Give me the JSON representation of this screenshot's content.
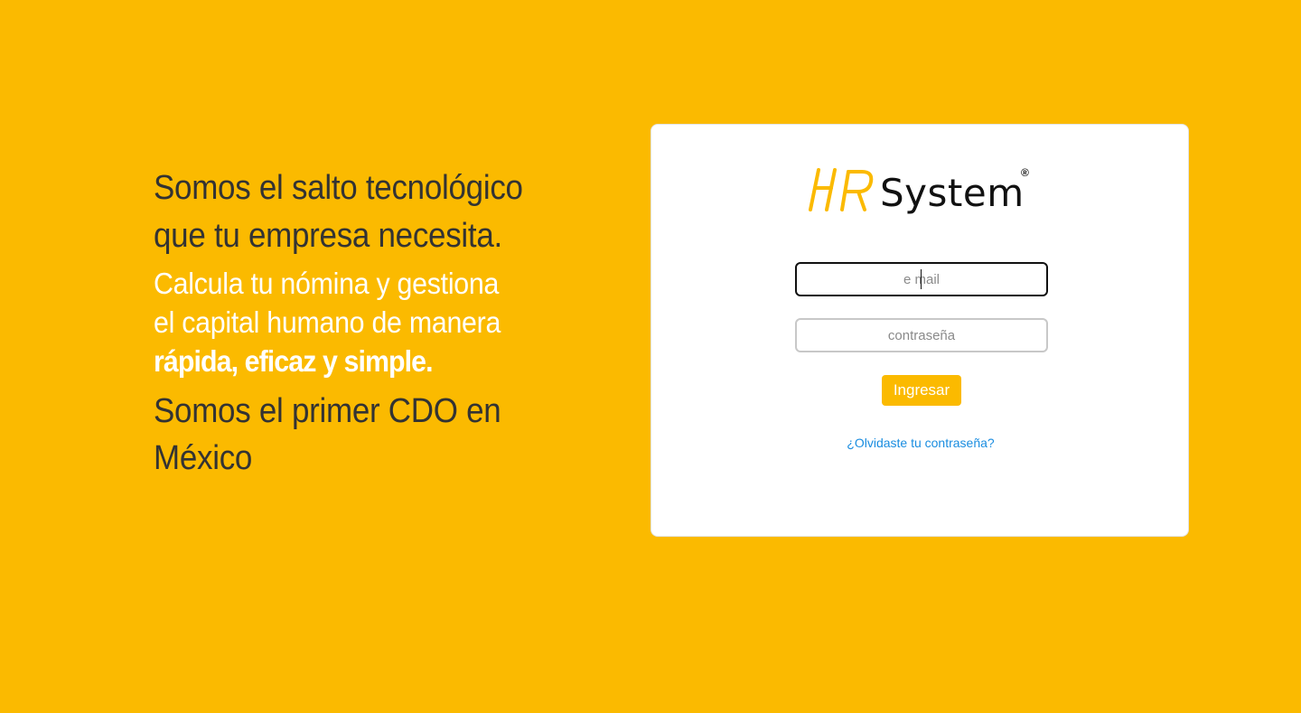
{
  "hero": {
    "headline_1": "Somos el salto tecnológico",
    "headline_2": "que tu empresa necesita.",
    "sub_1": "Calcula tu nómina y gestiona",
    "sub_2": "el capital humano de manera",
    "sub_bold": "rápida, eficaz y simple.",
    "cdo_1": "Somos el primer CDO en",
    "cdo_2": "México"
  },
  "logo": {
    "name": "System",
    "registered": "®",
    "mark_text": "HR",
    "mark_color": "#FBBA00"
  },
  "login": {
    "email_placeholder": "e mail",
    "email_value": "",
    "password_placeholder": "contraseña",
    "password_value": "",
    "submit_label": "Ingresar",
    "forgot_label": "¿Olvidaste tu contraseña?"
  },
  "colors": {
    "background": "#FBBA00",
    "accent": "#FBBA00",
    "link": "#1a8de0",
    "text_dark": "#333333"
  }
}
